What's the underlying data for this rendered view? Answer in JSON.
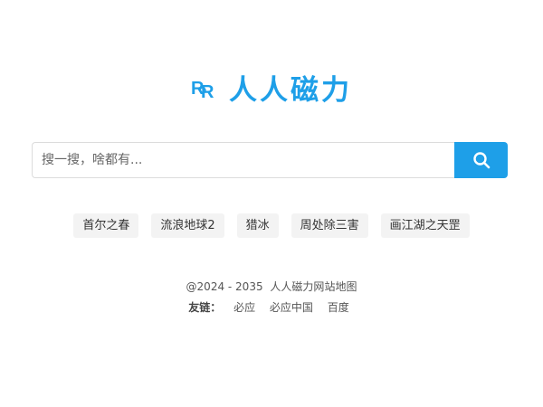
{
  "logo": {
    "text": "人人磁力",
    "accent_color": "#1e9fe8",
    "icon": "rr-logo-icon"
  },
  "search": {
    "placeholder": "搜一搜，啥都有...",
    "value": "",
    "button_icon": "search-icon"
  },
  "hot_tags": [
    {
      "label": "首尔之春"
    },
    {
      "label": "流浪地球2"
    },
    {
      "label": "猎冰"
    },
    {
      "label": "周处除三害"
    },
    {
      "label": "画江湖之天罡"
    }
  ],
  "footer": {
    "copyright": "@2024 - 2035",
    "site_name": "人人磁力网",
    "sitemap": "站地图",
    "friend_links_label": "友链：",
    "friend_links": [
      {
        "label": "必应"
      },
      {
        "label": "必应中国"
      },
      {
        "label": "百度"
      }
    ]
  }
}
